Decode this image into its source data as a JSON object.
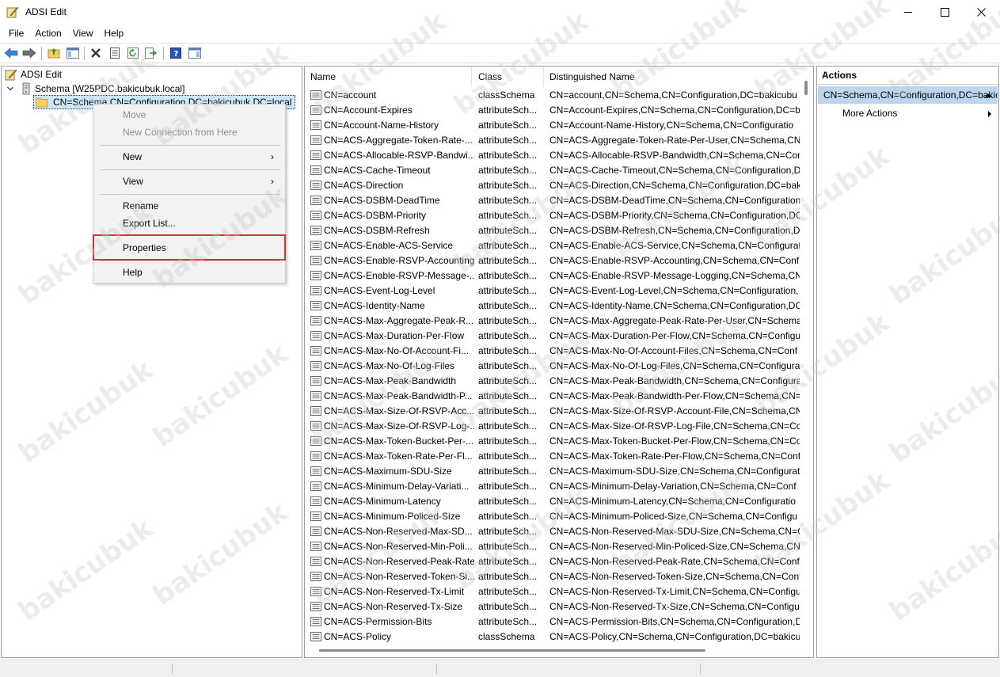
{
  "window": {
    "title": "ADSI Edit"
  },
  "menu": [
    "File",
    "Action",
    "View",
    "Help"
  ],
  "tree": {
    "root": "ADSI Edit",
    "connection": "Schema [W25PDC.bakicubuk.local]",
    "selected": "CN=Schema,CN=Configuration,DC=bakicubuk,DC=local"
  },
  "context_menu": {
    "items": [
      {
        "label": "Move",
        "disabled": true
      },
      {
        "label": "New Connection from Here",
        "disabled": true
      },
      {
        "label": "New",
        "submenu": true
      },
      {
        "label": "View",
        "submenu": true
      },
      {
        "label": "Rename"
      },
      {
        "label": "Export List..."
      },
      {
        "label": "Properties",
        "highlighted": true
      },
      {
        "label": "Help"
      }
    ]
  },
  "list": {
    "columns": [
      "Name",
      "Class",
      "Distinguished Name"
    ],
    "rows": [
      [
        "CN=account",
        "classSchema",
        "CN=account,CN=Schema,CN=Configuration,DC=bakicubu"
      ],
      [
        "CN=Account-Expires",
        "attributeSch...",
        "CN=Account-Expires,CN=Schema,CN=Configuration,DC=b"
      ],
      [
        "CN=Account-Name-History",
        "attributeSch...",
        "CN=Account-Name-History,CN=Schema,CN=Configuratio"
      ],
      [
        "CN=ACS-Aggregate-Token-Rate-...",
        "attributeSch...",
        "CN=ACS-Aggregate-Token-Rate-Per-User,CN=Schema,CN="
      ],
      [
        "CN=ACS-Allocable-RSVP-Bandwi...",
        "attributeSch...",
        "CN=ACS-Allocable-RSVP-Bandwidth,CN=Schema,CN=Con"
      ],
      [
        "CN=ACS-Cache-Timeout",
        "attributeSch...",
        "CN=ACS-Cache-Timeout,CN=Schema,CN=Configuration,D"
      ],
      [
        "CN=ACS-Direction",
        "attributeSch...",
        "CN=ACS-Direction,CN=Schema,CN=Configuration,DC=bak"
      ],
      [
        "CN=ACS-DSBM-DeadTime",
        "attributeSch...",
        "CN=ACS-DSBM-DeadTime,CN=Schema,CN=Configuration"
      ],
      [
        "CN=ACS-DSBM-Priority",
        "attributeSch...",
        "CN=ACS-DSBM-Priority,CN=Schema,CN=Configuration,DC"
      ],
      [
        "CN=ACS-DSBM-Refresh",
        "attributeSch...",
        "CN=ACS-DSBM-Refresh,CN=Schema,CN=Configuration,DC"
      ],
      [
        "CN=ACS-Enable-ACS-Service",
        "attributeSch...",
        "CN=ACS-Enable-ACS-Service,CN=Schema,CN=Configurati"
      ],
      [
        "CN=ACS-Enable-RSVP-Accounting",
        "attributeSch...",
        "CN=ACS-Enable-RSVP-Accounting,CN=Schema,CN=Confi"
      ],
      [
        "CN=ACS-Enable-RSVP-Message-...",
        "attributeSch...",
        "CN=ACS-Enable-RSVP-Message-Logging,CN=Schema,CN="
      ],
      [
        "CN=ACS-Event-Log-Level",
        "attributeSch...",
        "CN=ACS-Event-Log-Level,CN=Schema,CN=Configuration,"
      ],
      [
        "CN=ACS-Identity-Name",
        "attributeSch...",
        "CN=ACS-Identity-Name,CN=Schema,CN=Configuration,DC"
      ],
      [
        "CN=ACS-Max-Aggregate-Peak-R...",
        "attributeSch...",
        "CN=ACS-Max-Aggregate-Peak-Rate-Per-User,CN=Schema,"
      ],
      [
        "CN=ACS-Max-Duration-Per-Flow",
        "attributeSch...",
        "CN=ACS-Max-Duration-Per-Flow,CN=Schema,CN=Configu"
      ],
      [
        "CN=ACS-Max-No-Of-Account-Fi...",
        "attributeSch...",
        "CN=ACS-Max-No-Of-Account-Files,CN=Schema,CN=Conf"
      ],
      [
        "CN=ACS-Max-No-Of-Log-Files",
        "attributeSch...",
        "CN=ACS-Max-No-Of-Log-Files,CN=Schema,CN=Configura"
      ],
      [
        "CN=ACS-Max-Peak-Bandwidth",
        "attributeSch...",
        "CN=ACS-Max-Peak-Bandwidth,CN=Schema,CN=Configura"
      ],
      [
        "CN=ACS-Max-Peak-Bandwidth-P...",
        "attributeSch...",
        "CN=ACS-Max-Peak-Bandwidth-Per-Flow,CN=Schema,CN="
      ],
      [
        "CN=ACS-Max-Size-Of-RSVP-Acc...",
        "attributeSch...",
        "CN=ACS-Max-Size-Of-RSVP-Account-File,CN=Schema,CN="
      ],
      [
        "CN=ACS-Max-Size-Of-RSVP-Log-...",
        "attributeSch...",
        "CN=ACS-Max-Size-Of-RSVP-Log-File,CN=Schema,CN=Cor"
      ],
      [
        "CN=ACS-Max-Token-Bucket-Per-...",
        "attributeSch...",
        "CN=ACS-Max-Token-Bucket-Per-Flow,CN=Schema,CN=Co"
      ],
      [
        "CN=ACS-Max-Token-Rate-Per-Fl...",
        "attributeSch...",
        "CN=ACS-Max-Token-Rate-Per-Flow,CN=Schema,CN=Conf"
      ],
      [
        "CN=ACS-Maximum-SDU-Size",
        "attributeSch...",
        "CN=ACS-Maximum-SDU-Size,CN=Schema,CN=Configurati"
      ],
      [
        "CN=ACS-Minimum-Delay-Variati...",
        "attributeSch...",
        "CN=ACS-Minimum-Delay-Variation,CN=Schema,CN=Conf"
      ],
      [
        "CN=ACS-Minimum-Latency",
        "attributeSch...",
        "CN=ACS-Minimum-Latency,CN=Schema,CN=Configuratio"
      ],
      [
        "CN=ACS-Minimum-Policed-Size",
        "attributeSch...",
        "CN=ACS-Minimum-Policed-Size,CN=Schema,CN=Configu"
      ],
      [
        "CN=ACS-Non-Reserved-Max-SD...",
        "attributeSch...",
        "CN=ACS-Non-Reserved-Max-SDU-Size,CN=Schema,CN=Co"
      ],
      [
        "CN=ACS-Non-Reserved-Min-Poli...",
        "attributeSch...",
        "CN=ACS-Non-Reserved-Min-Policed-Size,CN=Schema,CN="
      ],
      [
        "CN=ACS-Non-Reserved-Peak-Rate",
        "attributeSch...",
        "CN=ACS-Non-Reserved-Peak-Rate,CN=Schema,CN=Config"
      ],
      [
        "CN=ACS-Non-Reserved-Token-Si...",
        "attributeSch...",
        "CN=ACS-Non-Reserved-Token-Size,CN=Schema,CN=Confi"
      ],
      [
        "CN=ACS-Non-Reserved-Tx-Limit",
        "attributeSch...",
        "CN=ACS-Non-Reserved-Tx-Limit,CN=Schema,CN=Configu"
      ],
      [
        "CN=ACS-Non-Reserved-Tx-Size",
        "attributeSch...",
        "CN=ACS-Non-Reserved-Tx-Size,CN=Schema,CN=Configur"
      ],
      [
        "CN=ACS-Permission-Bits",
        "attributeSch...",
        "CN=ACS-Permission-Bits,CN=Schema,CN=Configuration,D"
      ],
      [
        "CN=ACS-Policy",
        "classSchema",
        "CN=ACS-Policy,CN=Schema,CN=Configuration,DC=bakicu"
      ]
    ]
  },
  "actions": {
    "title": "Actions",
    "selected": "CN=Schema,CN=Configuration,DC=bakicubuk,DC=local",
    "more": "More Actions"
  },
  "watermark": "bakicubuk",
  "colors": {
    "selection": "#cce8ff",
    "actions_selected": "#bcd6ee",
    "highlight_border": "#e03030",
    "folder": "#f5cf63"
  }
}
